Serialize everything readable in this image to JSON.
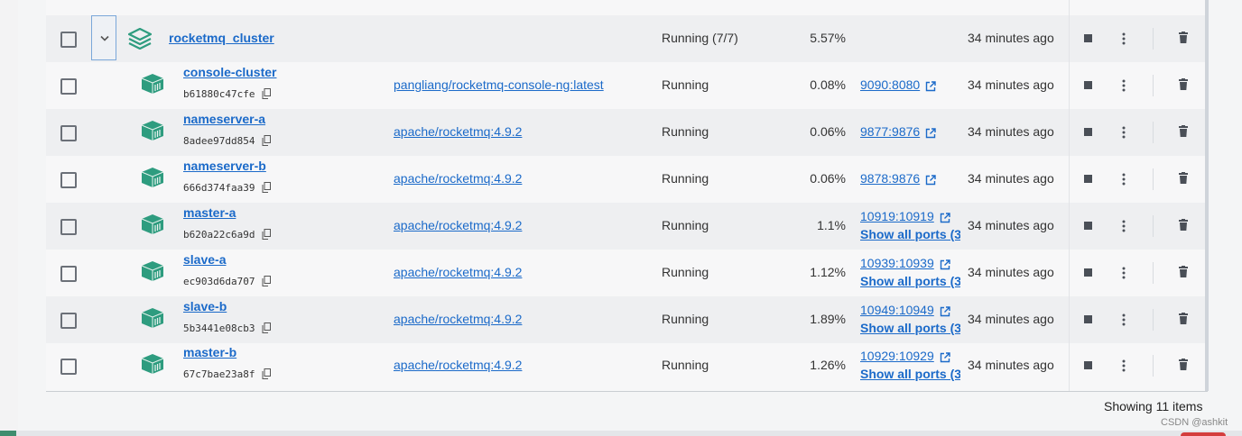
{
  "group": {
    "name": "rocketmq_cluster",
    "status": "Running (7/7)",
    "cpu": "5.57%",
    "started": "34 minutes ago"
  },
  "containers": [
    {
      "name": "console-cluster",
      "id": "b61880c47cfe",
      "image": "pangliang/rocketmq-console-ng:latest",
      "status": "Running",
      "cpu": "0.08%",
      "port": "9090:8080",
      "show_all": "",
      "started": "34 minutes ago"
    },
    {
      "name": "nameserver-a",
      "id": "8adee97dd854",
      "image": "apache/rocketmq:4.9.2",
      "status": "Running",
      "cpu": "0.06%",
      "port": "9877:9876",
      "show_all": "",
      "started": "34 minutes ago"
    },
    {
      "name": "nameserver-b",
      "id": "666d374faa39",
      "image": "apache/rocketmq:4.9.2",
      "status": "Running",
      "cpu": "0.06%",
      "port": "9878:9876",
      "show_all": "",
      "started": "34 minutes ago"
    },
    {
      "name": "master-a",
      "id": "b620a22c6a9d",
      "image": "apache/rocketmq:4.9.2",
      "status": "Running",
      "cpu": "1.1%",
      "port": "10919:10919",
      "show_all": "Show all ports (3",
      "started": "34 minutes ago"
    },
    {
      "name": "slave-a",
      "id": "ec903d6da707",
      "image": "apache/rocketmq:4.9.2",
      "status": "Running",
      "cpu": "1.12%",
      "port": "10939:10939",
      "show_all": "Show all ports (3",
      "started": "34 minutes ago"
    },
    {
      "name": "slave-b",
      "id": "5b3441e08cb3",
      "image": "apache/rocketmq:4.9.2",
      "status": "Running",
      "cpu": "1.89%",
      "port": "10949:10949",
      "show_all": "Show all ports (3",
      "started": "34 minutes ago"
    },
    {
      "name": "master-b",
      "id": "67c7bae23a8f",
      "image": "apache/rocketmq:4.9.2",
      "status": "Running",
      "cpu": "1.26%",
      "port": "10929:10929",
      "show_all": "Show all ports (3",
      "started": "34 minutes ago"
    }
  ],
  "footer": {
    "showing": "Showing 11 items"
  },
  "watermark": "CSDN @ashkit",
  "colors": {
    "link": "#1b6ac9",
    "container_icon": "#2e9c7f",
    "stop": "#4a4f57"
  },
  "icons": {
    "group": "stack-layers-icon",
    "container": "container-box-icon",
    "copy": "copy-icon",
    "external": "external-link-icon",
    "stop": "stop-icon",
    "more": "more-vertical-icon",
    "delete": "trash-icon",
    "expander": "chevron-down-icon"
  }
}
